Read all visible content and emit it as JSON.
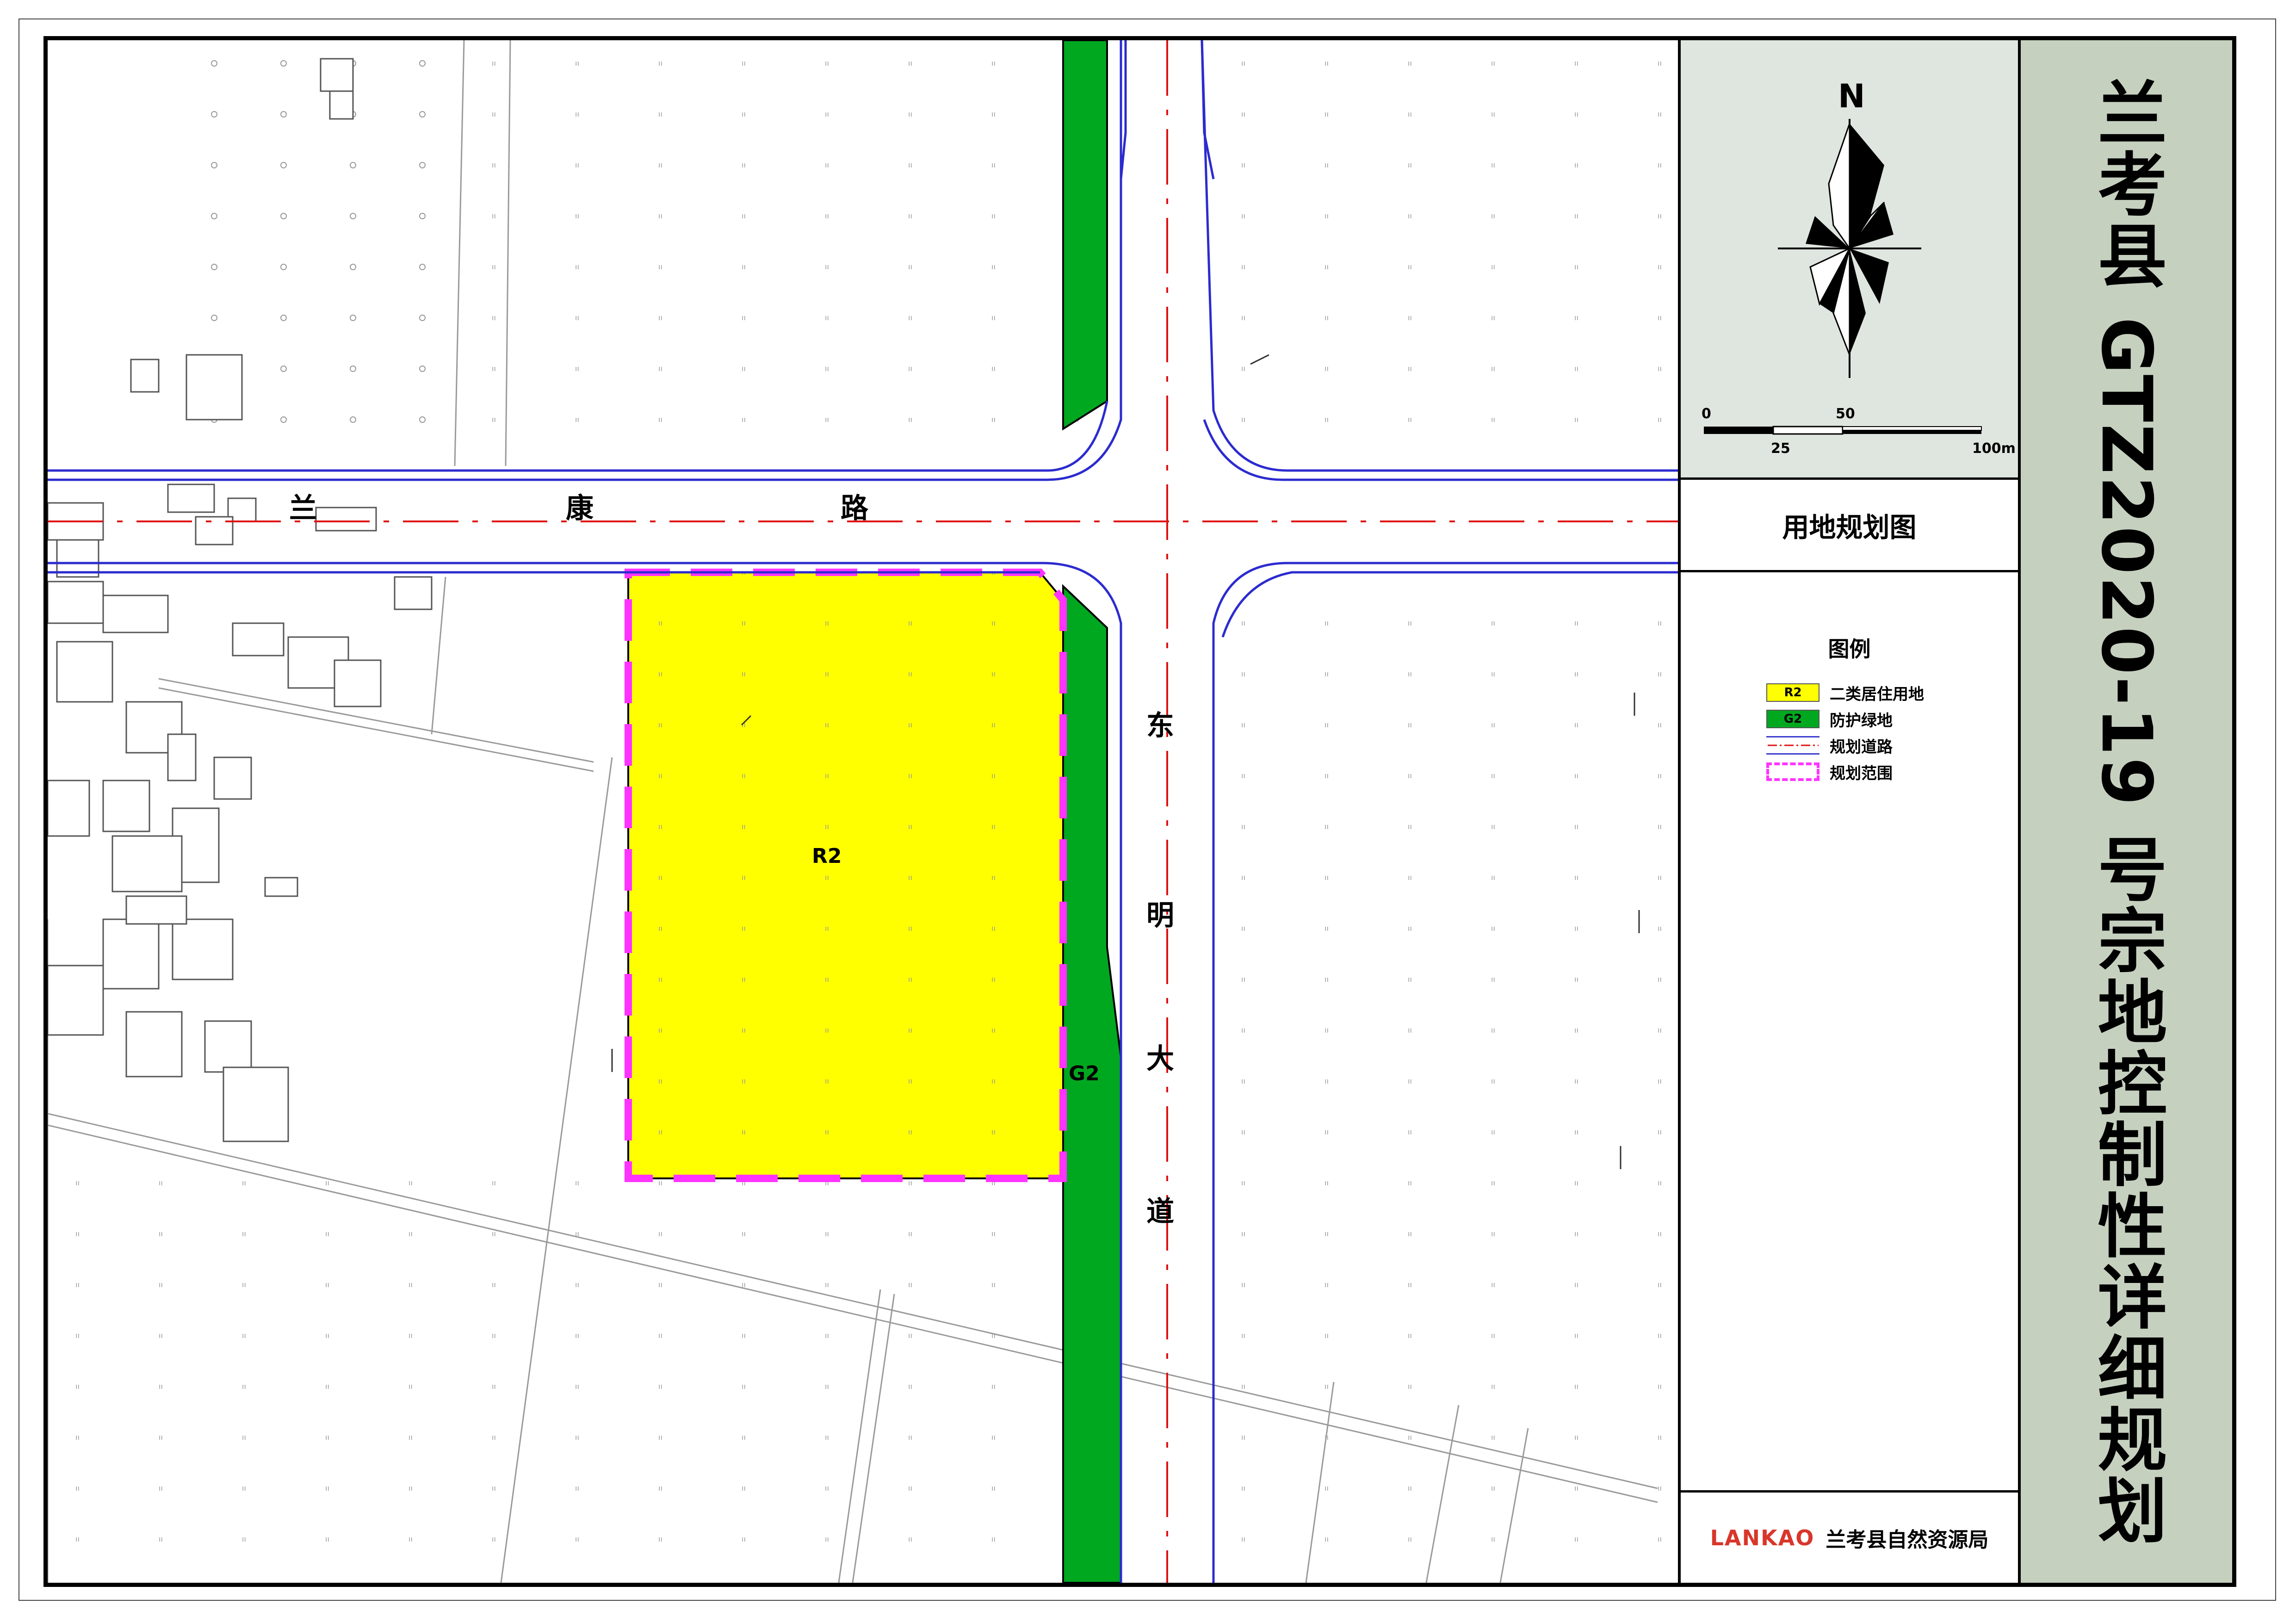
{
  "title": "兰考县 GTZ2020-19 号宗地控制性详细规划",
  "panel": {
    "north_label": "N",
    "scale_labels": {
      "zero": "0",
      "fifty": "50",
      "twenty_five": "25",
      "hundred": "100m"
    },
    "plan_title": "用地规划图",
    "legend_title": "图例",
    "legend": [
      {
        "code": "R2",
        "label": "二类居住用地",
        "color": "#ffff00"
      },
      {
        "code": "G2",
        "label": "防护绿地",
        "color": "#00a820"
      },
      {
        "code": "",
        "label": "规划道路",
        "color": "#3a3acf"
      },
      {
        "code": "",
        "label": "规划范围",
        "color": "#ff33ff"
      }
    ],
    "org_logo": "LANKAO",
    "org_name": "兰考县自然资源局"
  },
  "map": {
    "road_names": {
      "lankang": [
        "兰",
        "康",
        "路"
      ],
      "dongming": [
        "东",
        "明",
        "大",
        "道"
      ]
    },
    "zones": {
      "r2_code": "R2",
      "g2_code": "G2"
    },
    "colors": {
      "residential": "#ffff00",
      "green": "#00a820",
      "boundary": "#ff33ff",
      "road_edge": "#2b2bcf",
      "centerline": "#e01010"
    }
  }
}
